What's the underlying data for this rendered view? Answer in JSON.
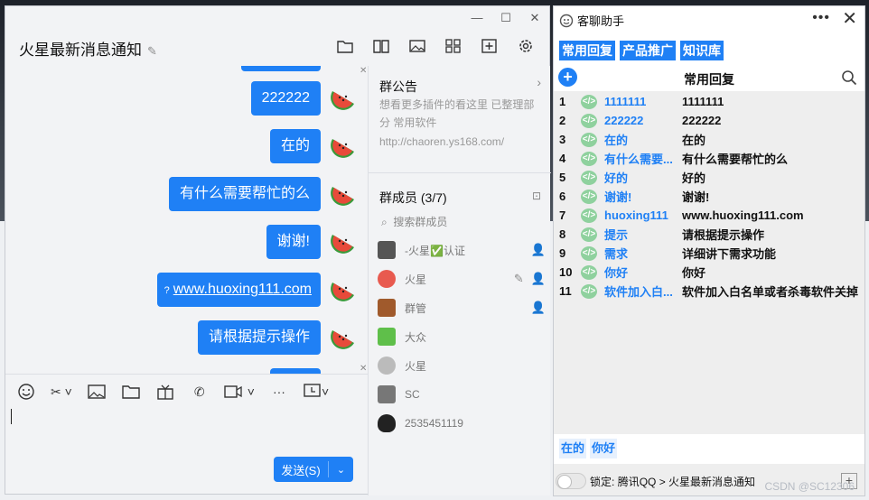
{
  "chat": {
    "title": "火星最新消息通知",
    "messages": [
      "222222",
      "在的",
      "有什么需要帮忙的么",
      "谢谢!",
      "www.huoxing111.com",
      "请根据提示操作"
    ],
    "link_prefix": "?",
    "send_label": "发送(S)",
    "notice": {
      "title": "群公告",
      "text": "想看更多插件的看这里  已整理部分 常用软件",
      "url": "http://chaoren.ys168.com/"
    },
    "members_title": "群成员 (3/7)",
    "member_search_placeholder": "搜索群成员",
    "members": [
      {
        "name": "-火星✅认证",
        "color": "#555555"
      },
      {
        "name": "火星",
        "color": "#e85a4f"
      },
      {
        "name": "群管",
        "color": "#a05a2c"
      },
      {
        "name": "大众",
        "color": "#5fbf4a"
      },
      {
        "name": "火星",
        "color": "#bbbbbb"
      },
      {
        "name": "SC",
        "color": "#777777"
      },
      {
        "name": "2535451119",
        "color": "#222222"
      }
    ]
  },
  "helper": {
    "title": "客聊助手",
    "tabs": [
      "常用回复",
      "产品推广",
      "知识库"
    ],
    "sub_title": "常用回复",
    "replies": [
      {
        "idx": "1",
        "key": "1111111",
        "val": "1111111"
      },
      {
        "idx": "2",
        "key": "222222",
        "val": "222222"
      },
      {
        "idx": "3",
        "key": "在的",
        "val": "在的"
      },
      {
        "idx": "4",
        "key": "有什么需要...",
        "val": "有什么需要帮忙的么"
      },
      {
        "idx": "5",
        "key": "好的",
        "val": "好的"
      },
      {
        "idx": "6",
        "key": "谢谢!",
        "val": "谢谢!"
      },
      {
        "idx": "7",
        "key": "huoxing111",
        "val": "www.huoxing111.com"
      },
      {
        "idx": "8",
        "key": "提示",
        "val": "请根据提示操作"
      },
      {
        "idx": "9",
        "key": "需求",
        "val": "详细讲下需求功能"
      },
      {
        "idx": "10",
        "key": "你好",
        "val": "你好"
      },
      {
        "idx": "11",
        "key": "软件加入白...",
        "val": "软件加入白名单或者杀毒软件关掉"
      }
    ],
    "quick_replies": [
      "在的",
      "你好"
    ],
    "lock_label": "锁定:",
    "lock_path": "腾讯QQ > 火星最新消息通知"
  },
  "watermark": "CSDN @SC12306",
  "colors": {
    "accent": "#1f80f5",
    "code_icon": "#8fd19e"
  }
}
